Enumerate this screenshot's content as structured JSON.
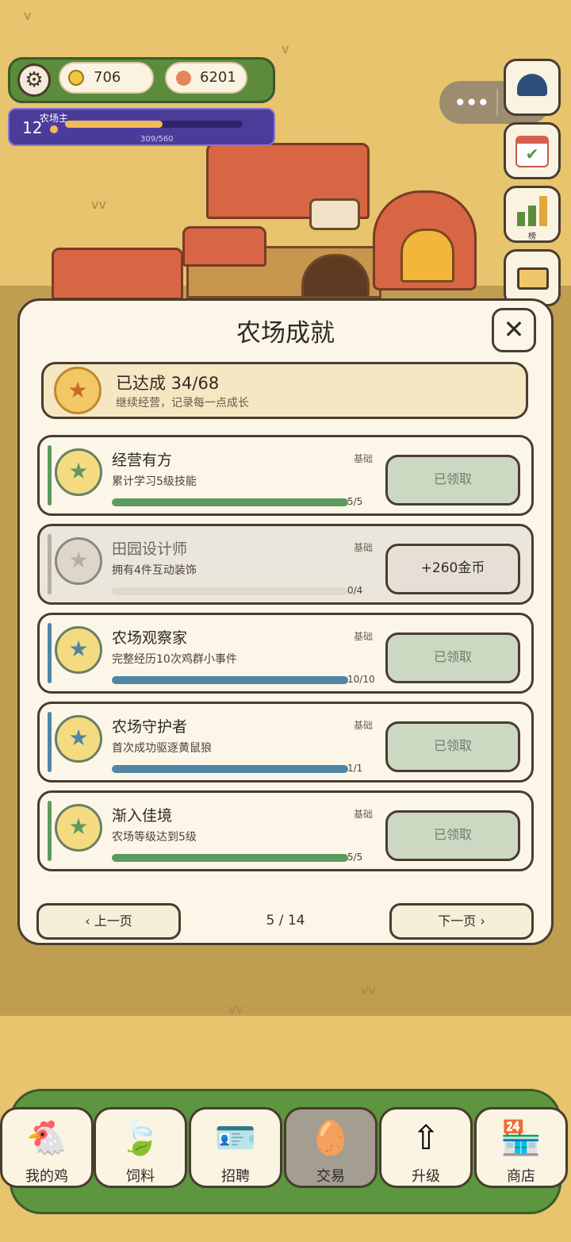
{
  "hud": {
    "coins": "706",
    "gems": "6201",
    "level": "12",
    "level_title": "农场主",
    "xp_text": "309/560",
    "xp_fraction": 0.55
  },
  "side_buttons": {
    "rank_label": "榜"
  },
  "modal": {
    "title": "农场成就",
    "close": "✕",
    "summary_title": "已达成 34/68",
    "summary_subtitle": "继续经营，记录每一点成长"
  },
  "achievements": [
    {
      "title": "经营有方",
      "desc": "累计学习5级技能",
      "tag": "基础",
      "progress": "5/5",
      "fraction": 1.0,
      "button": "已领取",
      "color": "#5d9a5f"
    },
    {
      "title": "田园设计师",
      "desc": "拥有4件互动装饰",
      "tag": "基础",
      "progress": "0/4",
      "fraction": 0.0,
      "button": "+260金币",
      "color": "#b5aea3"
    },
    {
      "title": "农场观察家",
      "desc": "完整经历10次鸡群小事件",
      "tag": "基础",
      "progress": "10/10",
      "fraction": 1.0,
      "button": "已领取",
      "color": "#4f86a6"
    },
    {
      "title": "农场守护者",
      "desc": "首次成功驱逐黄鼠狼",
      "tag": "基础",
      "progress": "1/1",
      "fraction": 1.0,
      "button": "已领取",
      "color": "#4f86a6"
    },
    {
      "title": "渐入佳境",
      "desc": "农场等级达到5级",
      "tag": "基础",
      "progress": "5/5",
      "fraction": 1.0,
      "button": "已领取",
      "color": "#5d9a5f"
    }
  ],
  "pagination": {
    "prev": "‹ 上一页",
    "next": "下一页 ›",
    "page": "5 / 14"
  },
  "nav": [
    {
      "label": "我的鸡",
      "icon": "chicken-icon"
    },
    {
      "label": "饲料",
      "icon": "leaf-icon"
    },
    {
      "label": "招聘",
      "icon": "badge-icon"
    },
    {
      "label": "交易",
      "icon": "eggs-icon"
    },
    {
      "label": "升级",
      "icon": "arrow-up-icon"
    },
    {
      "label": "商店",
      "icon": "shop-icon"
    }
  ]
}
